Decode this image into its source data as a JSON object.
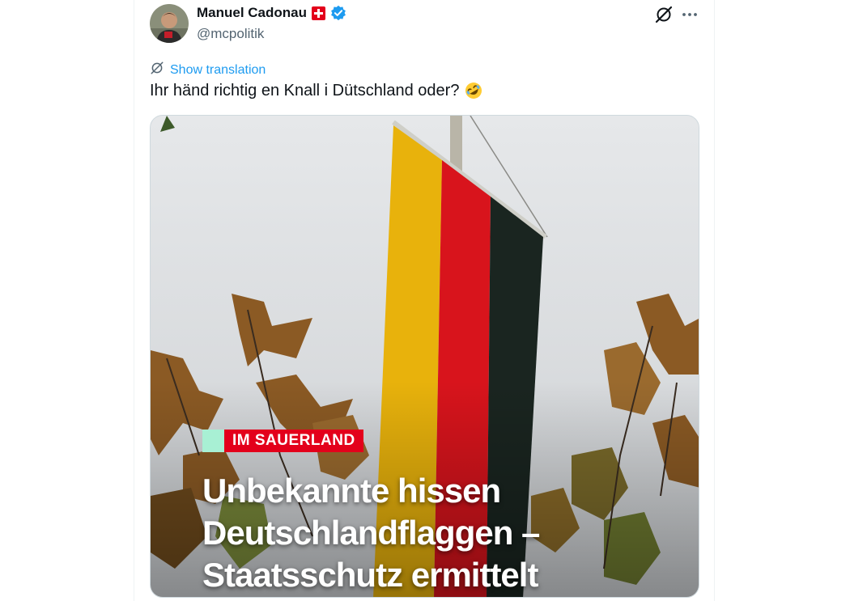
{
  "tweet": {
    "author_name": "Manuel Cadonau",
    "handle": "@mcpolitik",
    "show_translation": "Show translation",
    "text": "Ihr händ richtig en Knall i Dütschland oder?",
    "emoji": "rolling-on-floor-laughing",
    "accent_color": "#1d9bf0"
  },
  "media": {
    "badge": "IM SAUERLAND",
    "headline_lines": [
      "Unbekannte hissen",
      "Deutschlandflaggen –",
      "Staatsschutz ermittelt"
    ],
    "badge_color": "#e3001b",
    "badge_accent_color": "#a8f0d4"
  }
}
